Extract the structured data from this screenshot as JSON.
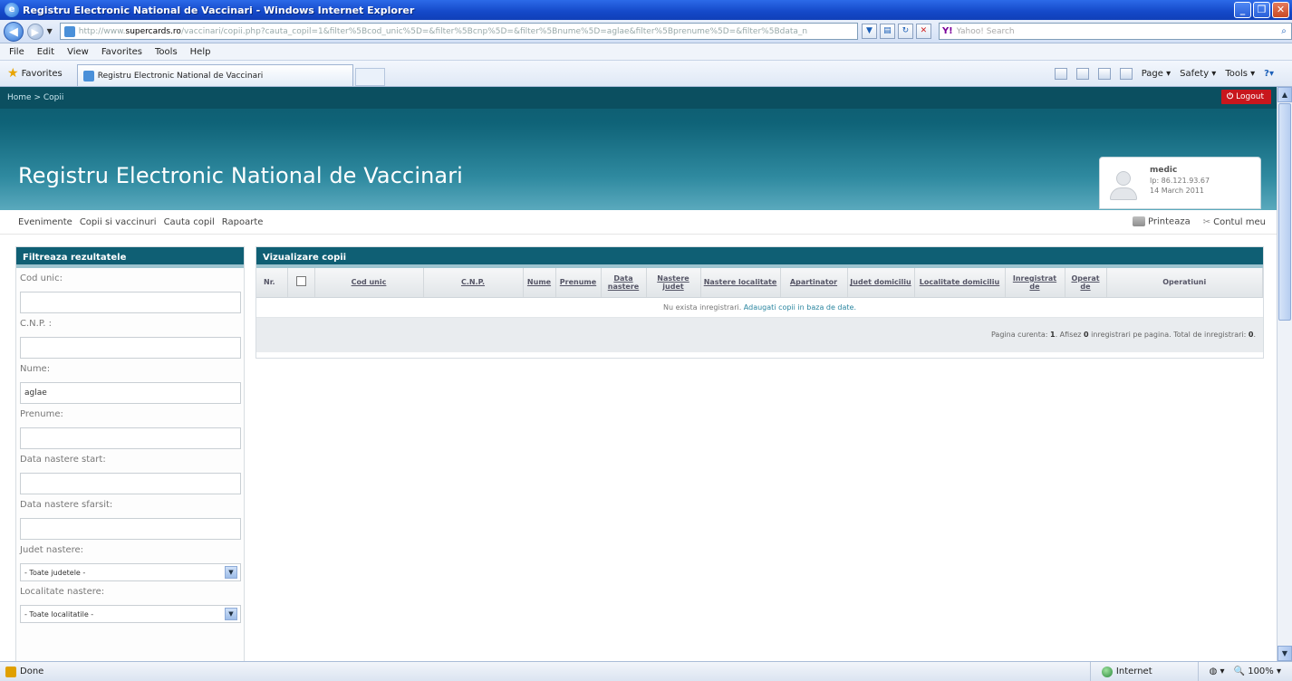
{
  "window": {
    "title": "Registru Electronic National de Vaccinari - Windows Internet Explorer"
  },
  "browser": {
    "url_domain": "supercards.ro",
    "url_rest": "/vaccinari/copii.php?cauta_copil=1&filter%5Bcod_unic%5D=&filter%5Bcnp%5D=&filter%5Bnume%5D=aglae&filter%5Bprenume%5D=&filter%5Bdata_n",
    "url_prefix": "http://www.",
    "search_brand": "Y!",
    "search_placeholder": "Yahoo! Search",
    "menu": [
      "File",
      "Edit",
      "View",
      "Favorites",
      "Tools",
      "Help"
    ],
    "favorites_label": "Favorites",
    "tab_title": "Registru Electronic National de Vaccinari",
    "cmd_page": "Page",
    "cmd_safety": "Safety",
    "cmd_tools": "Tools"
  },
  "header": {
    "breadcrumb": "Home > Copii",
    "logout_label": "Logout",
    "site_title": "Registru Electronic National de Vaccinari",
    "user": {
      "name": "medic",
      "ip": "Ip: 86.121.93.67",
      "date": "14 March 2011"
    }
  },
  "nav": {
    "items": [
      "Evenimente",
      "Copii si vaccinuri",
      "Cauta copil",
      "Rapoarte"
    ],
    "print_label": "Printeaza",
    "account_label": "Contul meu"
  },
  "filter": {
    "title": "Filtreaza rezultatele",
    "cod_unic": {
      "label": "Cod unic:",
      "value": ""
    },
    "cnp": {
      "label": "C.N.P. :",
      "value": ""
    },
    "nume": {
      "label": "Nume:",
      "value": "aglae"
    },
    "prenume": {
      "label": "Prenume:",
      "value": ""
    },
    "data_start": {
      "label": "Data nastere start:",
      "value": ""
    },
    "data_sfarsit": {
      "label": "Data nastere sfarsit:",
      "value": ""
    },
    "judet": {
      "label": "Judet nastere:",
      "selected": "- Toate judetele -"
    },
    "localitate": {
      "label": "Localitate nastere:",
      "selected": "- Toate localitatile -"
    }
  },
  "table": {
    "title": "Vizualizare copii",
    "columns": [
      "Nr.",
      "",
      "Cod unic",
      "C.N.P.",
      "Nume",
      "Prenume",
      "Data nastere",
      "Nastere judet",
      "Nastere localitate",
      "Apartinator",
      "Judet domiciliu",
      "Localitate domiciliu",
      "Inregistrat de",
      "Operat de",
      "Operatiuni"
    ],
    "empty_text": "Nu exista inregistrari.",
    "empty_link": "Adaugati copii in baza de date.",
    "pager": {
      "prefix": "Pagina curenta:",
      "page": "1",
      "mid": ". Afisez",
      "per_page": "0",
      "mid2": "inregistrari pe pagina. Total de inregistrari:",
      "total": "0",
      "end": "."
    }
  },
  "status": {
    "left": "Done",
    "zone": "Internet",
    "zoom": "100%"
  }
}
